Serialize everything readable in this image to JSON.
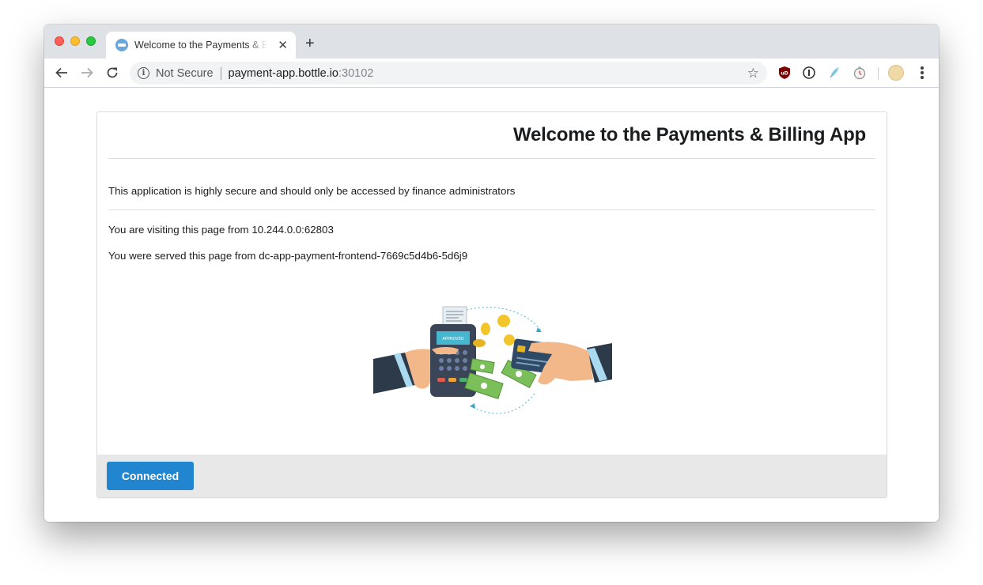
{
  "browser": {
    "tab_title": "Welcome to the Payments & Billing App",
    "new_tab_symbol": "+",
    "close_symbol": "✕",
    "security_label": "Not Secure",
    "url_host": "payment-app.bottle.io",
    "url_port": ":30102",
    "extension_icons": [
      "ublock-origin-icon",
      "info-icon",
      "feather-icon",
      "timer-icon"
    ],
    "ublock_badge": "uD"
  },
  "page": {
    "title": "Welcome to the Payments & Billing App",
    "notice": "This application is highly secure and should only be accessed by finance administrators",
    "visitor_info": "You are visiting this page from 10.244.0.0:62803",
    "served_info": "You were served this page from dc-app-payment-frontend-7669c5d4b6-5d6j9",
    "terminal_label": "APPROVED",
    "connected_button": "Connected"
  },
  "colors": {
    "primary_button": "#2185d0",
    "footer_bg": "#e8e8e8",
    "tabstrip_bg": "#dee1e6"
  }
}
